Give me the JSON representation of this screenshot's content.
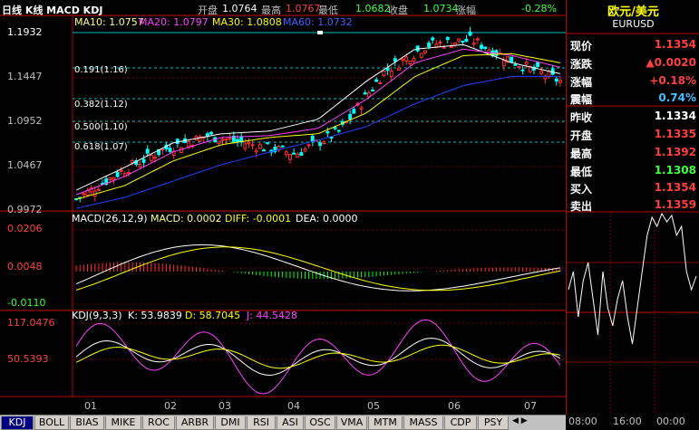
{
  "header": {
    "title": "日线 K线 MACD KDJ",
    "open_label": "开盘",
    "open_value": "1.0764",
    "high_label": "最高",
    "high_value": "1.0767",
    "low_label": "最低",
    "low_value": "1.0682",
    "close_label": "收盘",
    "close_value": "1.0734",
    "change_label": "涨幅",
    "change_value": "-0.28%"
  },
  "ma_legend": {
    "ma10": "MA10: 1.0757",
    "ma20": "MA20: 1.0797",
    "ma30": "MA30: 1.0808",
    "ma60": "MA60: 1.0732"
  },
  "price_axis": [
    "1.1932",
    "1.1447",
    "1.0952",
    "1.0467",
    "0.9972"
  ],
  "fib_levels": [
    "0.191(1.16)",
    "0.382(1.12)",
    "0.500(1.10)",
    "0.618(1.07)"
  ],
  "macd_legend": {
    "title": "MACD(26,12,9)",
    "macd": "MACD: 0.0002",
    "diff": "DIFF: -0.0001",
    "dea": "DEA: 0.0000"
  },
  "macd_axis": [
    "0.0206",
    "0.0048",
    "-0.0110"
  ],
  "kdj_legend": {
    "title": "KDJ(9,3,3)",
    "k": "K: 53.9839",
    "d": "D: 58.7045",
    "j": "J: 44.5428"
  },
  "kdj_axis": [
    "117.0476",
    "50.5393"
  ],
  "x_axis": [
    "01",
    "02",
    "03",
    "04",
    "05",
    "06",
    "07"
  ],
  "tabs": [
    "KDJ",
    "BOLL",
    "BIAS",
    "MIKE",
    "ROC",
    "ARBR",
    "DMI",
    "RSI",
    "ASI",
    "OSC",
    "VMA",
    "MTM",
    "MASS",
    "CDP",
    "PSY"
  ],
  "quote": {
    "name": "欧元/美元",
    "code": "EURUSD",
    "rows": [
      {
        "label": "现价",
        "value": "1.1354",
        "color": "#ff4040"
      },
      {
        "label": "涨跌",
        "value": "▲0.0020",
        "color": "#ff4040"
      },
      {
        "label": "涨幅",
        "value": "+0.18%",
        "color": "#ff4040"
      },
      {
        "label": "震幅",
        "value": "0.74%",
        "color": "#40c0ff"
      },
      {
        "label": "昨收",
        "value": "1.1334",
        "color": "#ffffff"
      },
      {
        "label": "开盘",
        "value": "1.1335",
        "color": "#ff4040"
      },
      {
        "label": "最高",
        "value": "1.1392",
        "color": "#ff4040"
      },
      {
        "label": "最低",
        "value": "1.1308",
        "color": "#40ff40"
      },
      {
        "label": "买入",
        "value": "1.1354",
        "color": "#ff4040"
      },
      {
        "label": "卖出",
        "value": "1.1359",
        "color": "#ff4040"
      }
    ],
    "times": [
      "08:00",
      "16:00",
      "00:00"
    ]
  },
  "chart_data": {
    "type": "candlestick",
    "title": "日线 K线",
    "x": [
      "01",
      "02",
      "03",
      "04",
      "05",
      "06",
      "07"
    ],
    "ylim": [
      0.9972,
      1.1932
    ],
    "series": [
      {
        "name": "MA10",
        "values": [
          1.02,
          1.045,
          1.072,
          1.082,
          1.085,
          1.098,
          1.14,
          1.175,
          1.18,
          1.16,
          1.148
        ]
      },
      {
        "name": "MA20",
        "values": [
          1.015,
          1.035,
          1.062,
          1.078,
          1.08,
          1.088,
          1.12,
          1.16,
          1.175,
          1.168,
          1.155
        ]
      },
      {
        "name": "MA30",
        "values": [
          1.01,
          1.025,
          1.052,
          1.07,
          1.078,
          1.082,
          1.105,
          1.145,
          1.168,
          1.17,
          1.16
        ]
      },
      {
        "name": "MA60",
        "values": [
          1.0,
          1.012,
          1.03,
          1.048,
          1.062,
          1.075,
          1.09,
          1.115,
          1.135,
          1.145,
          1.145
        ]
      }
    ],
    "close": [
      1.01,
      1.04,
      1.065,
      1.08,
      1.07,
      1.06,
      1.085,
      1.15,
      1.18,
      1.185,
      1.16,
      1.14
    ]
  }
}
